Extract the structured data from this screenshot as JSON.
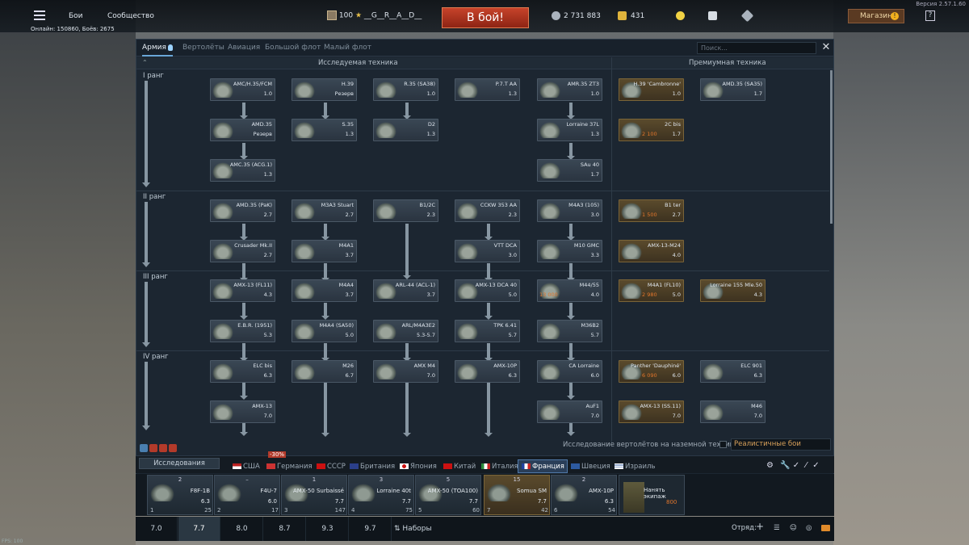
{
  "app": {
    "version": "Версия 2.57.1.60",
    "fps": "FPS: 100"
  },
  "topbar": {
    "menu_battles": "Бои",
    "menu_community": "Сообщество",
    "online": "Онлайн: 150860, Боёв: 2675",
    "player_level": "100",
    "player_name": "__G__R__A__D__",
    "battle_button": "В бой!",
    "silver_lions": "2 731 883",
    "golden_eagles": "431",
    "shop_label": "Магазин",
    "shop_badge": "!",
    "help_label": "?"
  },
  "tabs": {
    "items": [
      "Армия",
      "Вертолёты",
      "Авиация",
      "Большой флот",
      "Малый флот"
    ],
    "active": "Армия",
    "search_placeholder": "Поиск..."
  },
  "tree": {
    "header_researched": "Исследуемая техника",
    "header_premium": "Премиумная техника",
    "ranks": [
      {
        "label": "I ранг"
      },
      {
        "label": "II ранг"
      },
      {
        "label": "III ранг"
      },
      {
        "label": "IV ранг"
      }
    ],
    "vehicles": [
      {
        "name": "AMC/H.35/FCM",
        "br": "1.0",
        "gold": ""
      },
      {
        "name": "H.39",
        "br": "Резерв",
        "gold": ""
      },
      {
        "name": "R.35 (SA38)",
        "br": "1.0",
        "gold": ""
      },
      {
        "name": "P.7.T AA",
        "br": "1.3",
        "gold": ""
      },
      {
        "name": "AMR.35 ZT3",
        "br": "1.0",
        "gold": ""
      },
      {
        "name": "H.39 'Cambronne'",
        "br": "1.0",
        "gold": ""
      },
      {
        "name": "AMD.35 (SA35)",
        "br": "1.7",
        "gold": ""
      },
      {
        "name": "AMD.35",
        "br": "Резерв",
        "gold": ""
      },
      {
        "name": "S.35",
        "br": "1.3",
        "gold": ""
      },
      {
        "name": "D2",
        "br": "1.3",
        "gold": ""
      },
      {
        "name": "Lorraine 37L",
        "br": "1.3",
        "gold": ""
      },
      {
        "name": "2C bis",
        "br": "1.7",
        "gold": "2 100"
      },
      {
        "name": "AMC.35 (ACG.1)",
        "br": "1.3",
        "gold": ""
      },
      {
        "name": "SAu 40",
        "br": "1.7",
        "gold": ""
      },
      {
        "name": "AMD.35 (PaK)",
        "br": "2.7",
        "gold": ""
      },
      {
        "name": "M3A3 Stuart",
        "br": "2.7",
        "gold": ""
      },
      {
        "name": "B1/2C",
        "br": "2.3",
        "gold": ""
      },
      {
        "name": "CCKW 353 AA",
        "br": "2.3",
        "gold": ""
      },
      {
        "name": "M4A3 (105)",
        "br": "3.0",
        "gold": ""
      },
      {
        "name": "B1 ter",
        "br": "2.7",
        "gold": "1 500"
      },
      {
        "name": "Crusader Mk.II",
        "br": "2.7",
        "gold": ""
      },
      {
        "name": "M4A1",
        "br": "3.7",
        "gold": ""
      },
      {
        "name": "VTT DCA",
        "br": "3.0",
        "gold": ""
      },
      {
        "name": "M10 GMC",
        "br": "3.3",
        "gold": ""
      },
      {
        "name": "AMX-13-M24",
        "br": "4.0",
        "gold": ""
      },
      {
        "name": "AMX-13 (FL11)",
        "br": "4.3",
        "gold": ""
      },
      {
        "name": "M4A4",
        "br": "3.7",
        "gold": ""
      },
      {
        "name": "ARL-44 (ACL-1)",
        "br": "3.7",
        "gold": ""
      },
      {
        "name": "AMX-13 DCA 40",
        "br": "5.0",
        "gold": ""
      },
      {
        "name": "M44/55",
        "br": "4.0",
        "gold": "13 000"
      },
      {
        "name": "M4A1 (FL10)",
        "br": "5.0",
        "gold": "2 980"
      },
      {
        "name": "Lorraine 155 Mle.50",
        "br": "4.3",
        "gold": ""
      },
      {
        "name": "E.B.R. (1951)",
        "br": "5.3",
        "gold": ""
      },
      {
        "name": "M4A4 (SA50)",
        "br": "5.0",
        "gold": ""
      },
      {
        "name": "ARL/M4A3E2",
        "br": "5.3-5.7",
        "gold": ""
      },
      {
        "name": "TPK 6.41",
        "br": "5.7",
        "gold": ""
      },
      {
        "name": "M36B2",
        "br": "5.7",
        "gold": ""
      },
      {
        "name": "ELC bis",
        "br": "6.3",
        "gold": ""
      },
      {
        "name": "M26",
        "br": "6.7",
        "gold": ""
      },
      {
        "name": "AMX M4",
        "br": "7.0",
        "gold": ""
      },
      {
        "name": "AMX-10P",
        "br": "6.3",
        "gold": ""
      },
      {
        "name": "CA Lorraine",
        "br": "6.0",
        "gold": ""
      },
      {
        "name": "Panther 'Dauphiné'",
        "br": "6.0",
        "gold": "6 090"
      },
      {
        "name": "ELC 901",
        "br": "6.3",
        "gold": ""
      },
      {
        "name": "AMX-13",
        "br": "7.0",
        "gold": ""
      },
      {
        "name": "AuF1",
        "br": "7.0",
        "gold": ""
      },
      {
        "name": "AMX-13 (SS.11)",
        "br": "7.0",
        "gold": ""
      },
      {
        "name": "M46",
        "br": "7.0",
        "gold": ""
      }
    ],
    "heli_research_text": "Исследование вертолётов на наземной технике",
    "mode": "Реалистичные бои"
  },
  "nations": {
    "research_button": "Исследования",
    "items": [
      "США",
      "Германия",
      "СССР",
      "Британия",
      "Япония",
      "Китай",
      "Италия",
      "Франция",
      "Швеция",
      "Израиль"
    ],
    "selected": "Франция",
    "discount": "-30%"
  },
  "crew": {
    "slots": [
      {
        "top": "2",
        "name": "F8F-1B",
        "br": "6.3",
        "num": "1",
        "right": "25"
      },
      {
        "top": "–",
        "name": "F4U-7",
        "br": "6.0",
        "num": "2",
        "right": "17"
      },
      {
        "top": "1",
        "name": "AMX-50 Surbaissé",
        "br": "7.7",
        "num": "3",
        "right": "147"
      },
      {
        "top": "3",
        "name": "Lorraine 40t",
        "br": "7.7",
        "num": "4",
        "right": "75"
      },
      {
        "top": "5",
        "name": "AMX-50 (TOA100)",
        "br": "7.7",
        "num": "5",
        "right": "60"
      },
      {
        "top": "15",
        "name": "Somua SM",
        "br": "7.7",
        "num": "7",
        "right": "42"
      },
      {
        "top": "2",
        "name": "AMX-10P",
        "br": "6.3",
        "num": "6",
        "right": "54"
      }
    ],
    "hire_label": "Нанять экипаж",
    "hire_cost": "800"
  },
  "br_bar": {
    "tabs": [
      "7.0",
      "7.7",
      "8.0",
      "8.7",
      "9.3",
      "9.7"
    ],
    "selected": "7.7",
    "presets": "Наборы",
    "squad": "Отряд:"
  },
  "colors": {
    "accent": "#6aa7d8",
    "battle": "#b8381f",
    "premium": "#7a6438",
    "gold": "#e2762c"
  }
}
